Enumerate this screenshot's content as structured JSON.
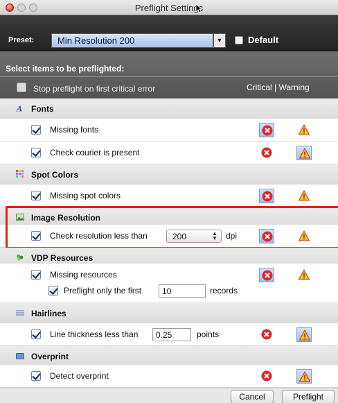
{
  "window": {
    "title": "Preflight Settings"
  },
  "preset": {
    "label": "Preset:",
    "value": "Min Resolution 200",
    "default_label": "Default"
  },
  "header": {
    "title": "Select items to be preflighted:",
    "stop_label": "Stop preflight on first critical error",
    "columns_label": "Critical | Warning"
  },
  "sections": {
    "fonts": {
      "label": "Fonts",
      "missing_fonts": "Missing fonts",
      "courier": "Check courier is present"
    },
    "spot": {
      "label": "Spot Colors",
      "missing_spot": "Missing spot colors"
    },
    "image": {
      "label": "Image Resolution",
      "check_label": "Check resolution less than",
      "value": "200",
      "unit": "dpi"
    },
    "vdp": {
      "label": "VDP Resources",
      "missing_resources": "Missing resources",
      "only_first_label": "Preflight only the first",
      "records_value": "10",
      "records_unit": "records"
    },
    "hairlines": {
      "label": "Hairlines",
      "thickness_label": "Line thickness less than",
      "value": "0.25",
      "unit": "points"
    },
    "overprint": {
      "label": "Overprint",
      "detect_label": "Detect overprint"
    }
  },
  "buttons": {
    "cancel": "Cancel",
    "preflight": "Preflight"
  },
  "colors": {
    "critical": "#e0252a",
    "warning": "#f5c518",
    "highlight": "#e2211c",
    "selection": "#9fbde6"
  }
}
